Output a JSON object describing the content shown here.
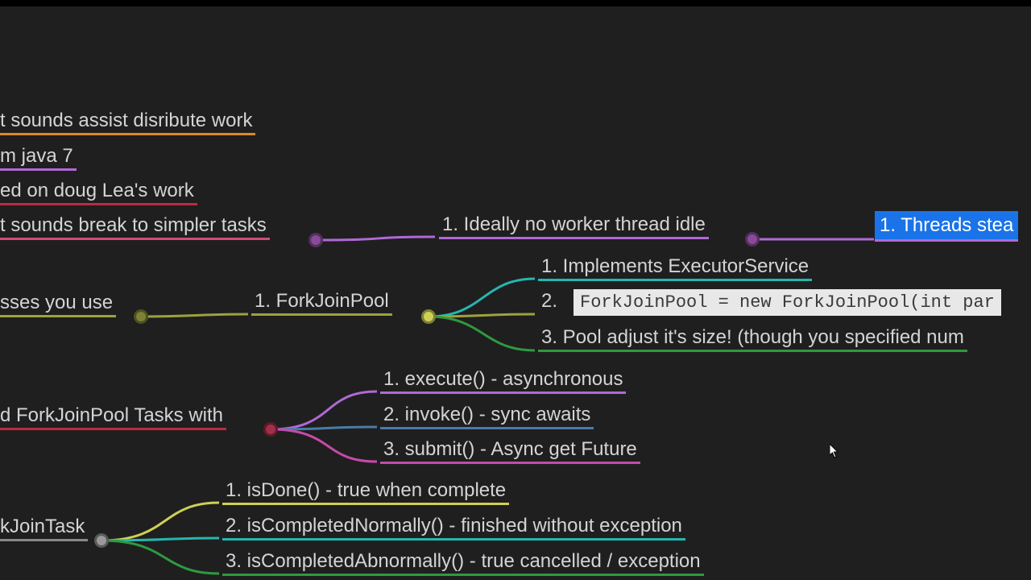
{
  "colors": {
    "bg": "#1f1f1f",
    "text": "#d4d4d4",
    "orange": "#dd8a2a",
    "purple": "#b069d6",
    "crimson": "#c0293f",
    "pink": "#d44a7a",
    "olive": "#9ea13e",
    "teal": "#25b7b0",
    "green": "#2e9a3f",
    "fuchsia": "#c64aa8",
    "steel": "#4a7ba6",
    "gray": "#888888",
    "yellow": "#cfcf55",
    "blueSel": "#1a73e8"
  },
  "nodes": {
    "n1": "t sounds assist disribute work",
    "n2": "m java 7",
    "n3": "ed on doug Lea's work",
    "n4": "t sounds break to simpler tasks",
    "n5": "1. Ideally no worker thread idle",
    "n6": "1. Threads stea",
    "n7": "sses you use",
    "n8": "1. ForkJoinPool",
    "n9": "1. Implements ExecutorService",
    "n10": "ForkJoinPool = new ForkJoinPool(int par",
    "n10num": "2.",
    "n11": "3. Pool adjust it's size! (though you specified num",
    "n12": "d ForkJoinPool Tasks with",
    "n13": "1. execute() - asynchronous",
    "n14": "2. invoke() - sync awaits",
    "n15": "3. submit() - Async get Future",
    "n16": "kJoinTask",
    "n17": "1. isDone() - true when complete",
    "n18": "2. isCompletedNormally() - finished without exception",
    "n19": "3. isCompletedAbnormally() - true cancelled / exception"
  }
}
